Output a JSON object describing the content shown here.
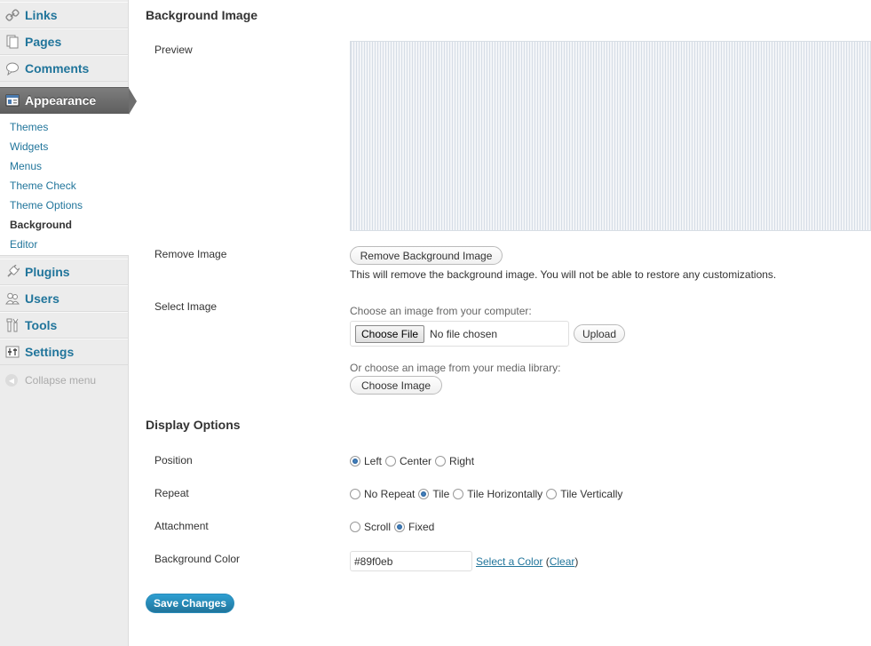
{
  "sidebar": {
    "links": "Links",
    "pages": "Pages",
    "comments": "Comments",
    "appearance": "Appearance",
    "submenu": [
      "Themes",
      "Widgets",
      "Menus",
      "Theme Check",
      "Theme Options",
      "Background",
      "Editor"
    ],
    "plugins": "Plugins",
    "users": "Users",
    "tools": "Tools",
    "settings": "Settings",
    "collapse": "Collapse menu"
  },
  "background_image": {
    "heading": "Background Image",
    "preview_label": "Preview",
    "remove_label": "Remove Image",
    "remove_button": "Remove Background Image",
    "remove_desc": "This will remove the background image. You will not be able to restore any customizations.",
    "select_label": "Select Image",
    "choose_computer": "Choose an image from your computer:",
    "choose_file": "Choose File",
    "no_file": "No file chosen",
    "upload": "Upload",
    "choose_library": "Or choose an image from your media library:",
    "choose_image": "Choose Image"
  },
  "display_options": {
    "heading": "Display Options",
    "position_label": "Position",
    "position_options": [
      "Left",
      "Center",
      "Right"
    ],
    "position_selected": "Left",
    "repeat_label": "Repeat",
    "repeat_options": [
      "No Repeat",
      "Tile",
      "Tile Horizontally",
      "Tile Vertically"
    ],
    "repeat_selected": "Tile",
    "attachment_label": "Attachment",
    "attachment_options": [
      "Scroll",
      "Fixed"
    ],
    "attachment_selected": "Fixed",
    "color_label": "Background Color",
    "color_value": "#89f0eb",
    "select_color": "Select a Color",
    "clear": "Clear",
    "paren_open": "(",
    "paren_close": ")"
  },
  "save_button": "Save Changes",
  "colors": {
    "link": "#21759b",
    "primary_button": "#21759b",
    "active_menu": "#6e6e6e"
  }
}
